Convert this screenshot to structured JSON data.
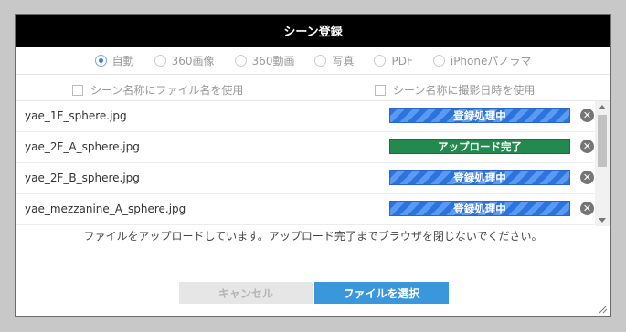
{
  "dialog": {
    "title": "シーン登録",
    "modes": [
      {
        "label": "自動",
        "checked": true
      },
      {
        "label": "360画像",
        "checked": false
      },
      {
        "label": "360動画",
        "checked": false
      },
      {
        "label": "写真",
        "checked": false
      },
      {
        "label": "PDF",
        "checked": false
      },
      {
        "label": "iPhoneパノラマ",
        "checked": false
      }
    ],
    "options": {
      "use_filename": "シーン名称にファイル名を使用",
      "use_date": "シーン名称に撮影日時を使用"
    },
    "files": [
      {
        "name": "yae_1F_sphere.jpg",
        "status": "登録処理中",
        "state": "processing"
      },
      {
        "name": "yae_2F_A_sphere.jpg",
        "status": "アップロード完了",
        "state": "done"
      },
      {
        "name": "yae_2F_B_sphere.jpg",
        "status": "登録処理中",
        "state": "processing"
      },
      {
        "name": "yae_mezzanine_A_sphere.jpg",
        "status": "登録処理中",
        "state": "processing"
      }
    ],
    "remove_icon": "close-circle-icon",
    "notice": "ファイルをアップロードしています。アップロード完了までブラウザを閉じないでください。",
    "cancel_label": "キャンセル",
    "select_label": "ファイルを選択",
    "colors": {
      "titlebar": "#000000",
      "processing": "#2d73e0",
      "done": "#238a4f",
      "select_button": "#3a97dc"
    }
  }
}
